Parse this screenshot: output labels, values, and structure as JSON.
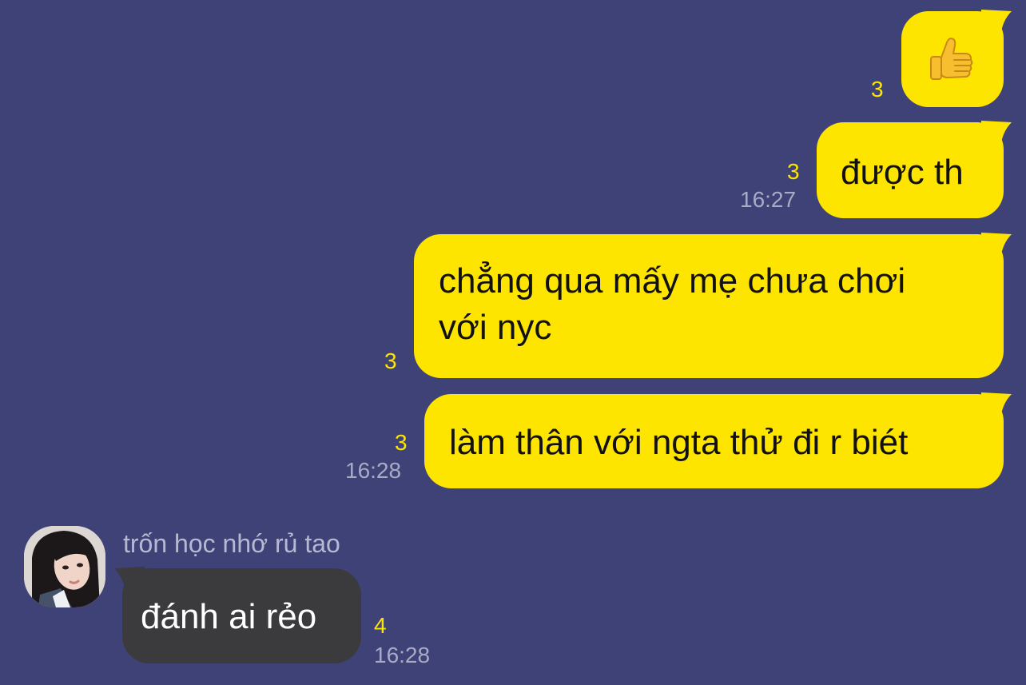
{
  "conversation": {
    "messages": [
      {
        "sender": "me",
        "content": "👍",
        "content_type": "emoji",
        "emoji_icon": "thumbs-up-icon",
        "unread_count": "3",
        "time": ""
      },
      {
        "sender": "me",
        "content": "được th",
        "unread_count": "3",
        "time": "16:27"
      },
      {
        "sender": "me",
        "lines": [
          "chẳng qua mấy mẹ chưa chơi",
          "với nyc"
        ],
        "unread_count": "3",
        "time": ""
      },
      {
        "sender": "me",
        "content": "làm thân với ngta thử đi r biét",
        "unread_count": "3",
        "time": "16:28"
      },
      {
        "sender": "other",
        "sender_name": "trốn học nhớ rủ tao",
        "content": "đánh ai rẻo",
        "unread_count": "4",
        "time": "16:28"
      }
    ]
  },
  "colors": {
    "background": "#3e4276",
    "outgoing_bubble": "#fee500",
    "incoming_bubble": "#3b3b3e",
    "unread_count": "#fee500",
    "timestamp": "#a9abc6"
  }
}
